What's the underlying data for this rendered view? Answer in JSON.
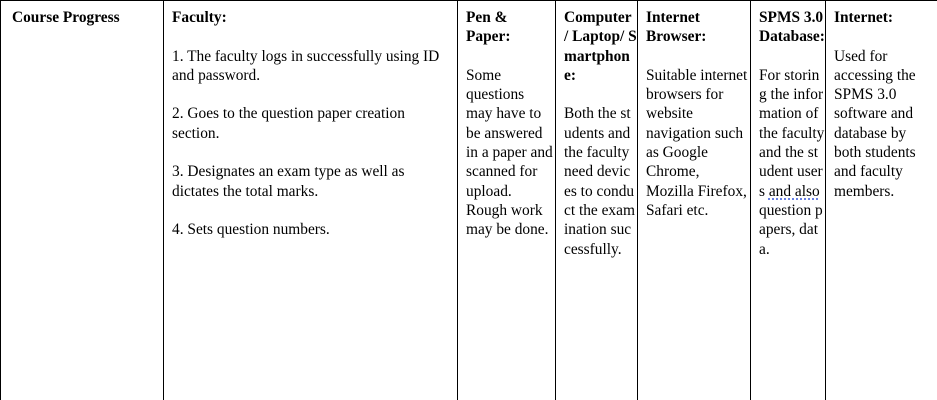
{
  "row": {
    "label": "Course Progress",
    "faculty": {
      "heading": "Faculty:",
      "steps": [
        "1. The faculty logs in successfully using ID and password.",
        "2. Goes to the question paper creation section.",
        "3. Designates an exam type as well as dictates the total marks.",
        "4. Sets question numbers."
      ]
    },
    "pen_paper": {
      "heading": "Pen & Paper:",
      "body": "Some questions may have to be answered in a paper and scanned for upload. Rough work may be done."
    },
    "devices": {
      "heading": "Computer / Laptop/ Smartphone:",
      "body": "Both the students and the faculty need devices to conduct the examination successfully."
    },
    "browser": {
      "heading": "Internet Browser:",
      "body": "Suitable internet browsers for website navigation such as Google Chrome, Mozilla Firefox, Safari etc."
    },
    "database": {
      "heading": "SPMS 3.0 Database:",
      "body_before": "For storing the information of the faculty and the student users ",
      "body_marked": "and also",
      "body_after": " question papers, data."
    },
    "internet": {
      "heading": "Internet:",
      "body": "Used for accessing the SPMS 3.0 software and database by both students and faculty members."
    }
  }
}
